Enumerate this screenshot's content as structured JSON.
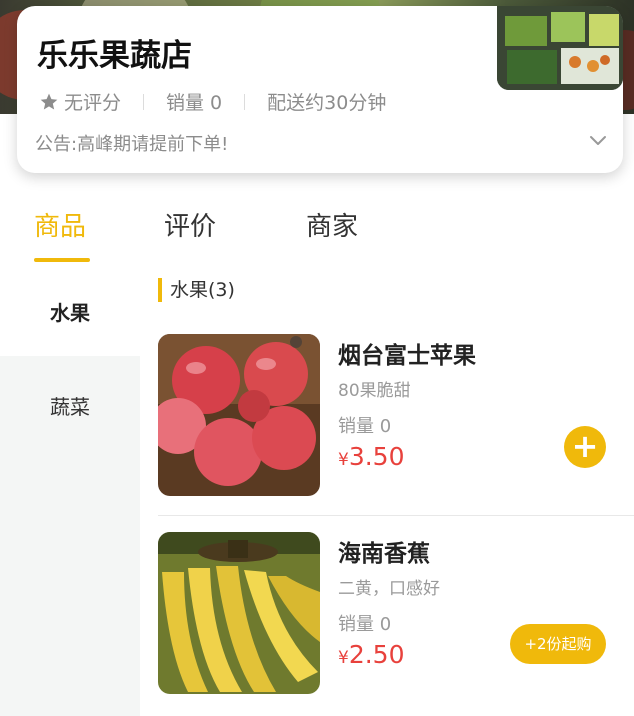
{
  "store": {
    "name": "乐乐果蔬店",
    "rating": "无评分",
    "sales": "销量 0",
    "delivery": "配送约30分钟",
    "notice": "公告:高峰期请提前下单!"
  },
  "tabs": [
    {
      "label": "商品",
      "active": true
    },
    {
      "label": "评价",
      "active": false
    },
    {
      "label": "商家",
      "active": false
    }
  ],
  "categories": [
    {
      "label": "水果",
      "active": true
    },
    {
      "label": "蔬菜",
      "active": false
    }
  ],
  "section": {
    "title": "水果(3)"
  },
  "products": [
    {
      "name": "烟台富士苹果",
      "desc": "80果脆甜",
      "sales": "销量 0",
      "currency": "¥",
      "price": "3.50",
      "action": "+"
    },
    {
      "name": "海南香蕉",
      "desc": "二黄，口感好",
      "sales": "销量 0",
      "currency": "¥",
      "price": "2.50",
      "action": "+2份起购"
    }
  ],
  "colors": {
    "accent": "#f0b90b",
    "price": "#e8413c"
  }
}
